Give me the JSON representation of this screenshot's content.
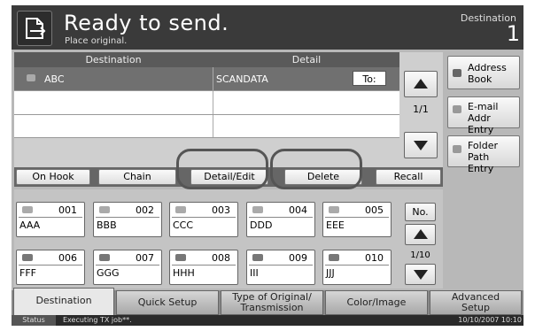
{
  "header": {
    "title": "Ready to send.",
    "subtitle": "Place original.",
    "right_label": "Destination",
    "right_count": "1"
  },
  "dest_list": {
    "col_destination": "Destination",
    "col_detail": "Detail",
    "rows": [
      {
        "name": "ABC",
        "detail": "SCANDATA",
        "type_button": "To:"
      }
    ],
    "page": "1/1"
  },
  "actions": {
    "on_hook": "On Hook",
    "chain": "Chain",
    "detail_edit": "Detail/Edit",
    "delete": "Delete",
    "recall": "Recall"
  },
  "side": {
    "address_book": "Address Book",
    "email_entry": "E-mail Addr Entry",
    "folder_entry": "Folder Path Entry"
  },
  "keys": [
    {
      "num": "001",
      "name": "AAA"
    },
    {
      "num": "002",
      "name": "BBB"
    },
    {
      "num": "003",
      "name": "CCC"
    },
    {
      "num": "004",
      "name": "DDD"
    },
    {
      "num": "005",
      "name": "EEE"
    },
    {
      "num": "006",
      "name": "FFF"
    },
    {
      "num": "007",
      "name": "GGG"
    },
    {
      "num": "008",
      "name": "HHH"
    },
    {
      "num": "009",
      "name": "III"
    },
    {
      "num": "010",
      "name": "JJJ"
    }
  ],
  "keys_nav": {
    "no_label": "No.",
    "page": "1/10"
  },
  "tabs": {
    "destination": "Destination",
    "quick_setup": "Quick Setup",
    "type_original_1": "Type of Original/",
    "type_original_2": "Transmission",
    "color_image": "Color/Image",
    "advanced_1": "Advanced",
    "advanced_2": "Setup"
  },
  "status": {
    "label": "Status",
    "message": "Executing TX job**.",
    "datetime": "10/10/2007  10:10"
  }
}
